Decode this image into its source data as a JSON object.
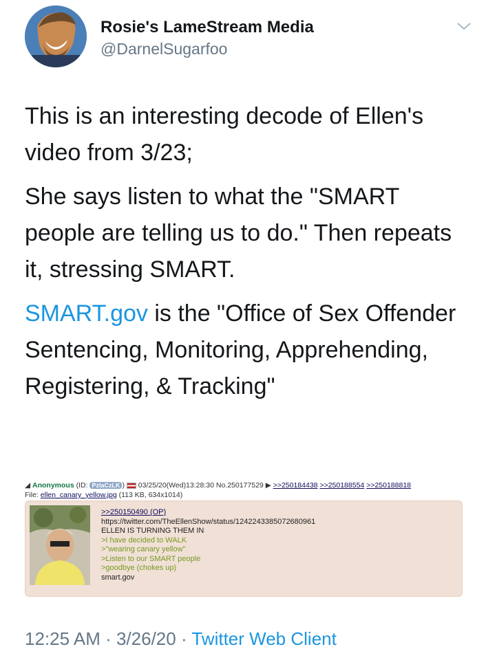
{
  "user": {
    "display_name": "Rosie's LameStream Media",
    "handle": "@DarnelSugarfoo"
  },
  "tweet": {
    "p1": "This is an interesting decode of Ellen's video from 3/23;",
    "p2": "She says listen to what the \"SMART people are telling us to do.\" Then repeats it, stressing SMART.",
    "p3_link": "SMART.gov",
    "p3_rest": " is the \"Office of Sex Offender Sentencing, Monitoring, Apprehending, Registering, & Tracking\""
  },
  "post": {
    "name": "Anonymous",
    "id_prefix": "(ID: ",
    "id": "PzlaCzLK",
    "id_suffix": ")",
    "datetime": "03/25/20(Wed)13:28:30",
    "number": "No.250177529",
    "replies": [
      ">>250184438",
      ">>250188554",
      ">>250188818"
    ],
    "file_label": "File: ",
    "file_name": "ellen_canary_yellow.jpg",
    "file_info": " (113 KB, 634x1014)",
    "op_ref": ">>250150490 (OP)",
    "lines": [
      "https://twitter.com/TheEllenShow/status/1242243385072680961",
      "ELLEN IS TURNING THEM IN"
    ],
    "greentext": [
      ">I have decided to WALK",
      ">\"wearing canary yellow\"",
      ">Listen to our SMART people",
      ">goodbye (chokes up)"
    ],
    "last_line": "smart.gov"
  },
  "footer": {
    "time": "12:25 AM",
    "sep1": " · ",
    "date": "3/26/20",
    "sep2": " · ",
    "client": "Twitter Web Client"
  },
  "colors": {
    "link": "#1b95e0",
    "secondary_text": "#657786",
    "post_background": "#f0e0d6",
    "greentext": "#789922",
    "poster_name": "#117743"
  },
  "icons": [
    "avatar-photo",
    "chevron-down-icon",
    "file-icon",
    "flag-icon",
    "reply-arrow-icon"
  ]
}
